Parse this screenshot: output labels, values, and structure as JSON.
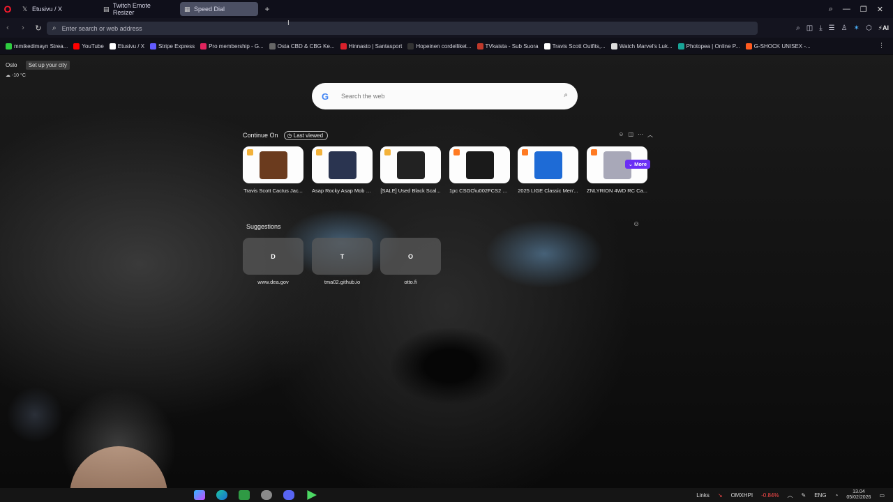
{
  "tabs": [
    {
      "label": "Etusivu / X",
      "icon": "x-logo-icon",
      "active": false
    },
    {
      "label": "Twitch Emote Resizer",
      "icon": "page-icon",
      "active": false
    },
    {
      "label": "Speed Dial",
      "icon": "speed-dial-icon",
      "active": true
    }
  ],
  "address": {
    "placeholder": "Enter search or web address"
  },
  "bookmarks": [
    {
      "label": "mmikedimayn Strea...",
      "color": "#2ecc40"
    },
    {
      "label": "YouTube",
      "color": "#ff0000"
    },
    {
      "label": "Etusivu / X",
      "color": "#ffffff"
    },
    {
      "label": "Stripe Express",
      "color": "#635bff"
    },
    {
      "label": "Pro membership - G...",
      "color": "#e0245e"
    },
    {
      "label": "Osta CBD & CBG Ke...",
      "color": "#666666"
    },
    {
      "label": "Hinnasto | Santasport",
      "color": "#d9202b"
    },
    {
      "label": "Hopeinen cordelliket...",
      "color": "#333333"
    },
    {
      "label": "TVkaista - Sub Suora",
      "color": "#c0392b"
    },
    {
      "label": "Travis Scott Outfits,...",
      "color": "#ffffff"
    },
    {
      "label": "Watch Marvel's Luk...",
      "color": "#dddddd"
    },
    {
      "label": "Photopea | Online P...",
      "color": "#18a497"
    },
    {
      "label": "G-SHOCK UNISEX -...",
      "color": "#ff5a1f"
    }
  ],
  "weather": {
    "city": "Oslo",
    "setup": "Set up your city",
    "temp": "-10 °C"
  },
  "search": {
    "placeholder": "Search the web",
    "engine": "G"
  },
  "continue_on": {
    "title": "Continue On",
    "filter": "Last viewed",
    "more": "More",
    "items": [
      {
        "label": "Travis Scott Cactus Jac...",
        "tag_color": "#f3b23a",
        "img_color": "#6b3b1e"
      },
      {
        "label": "Asap Rocky Asap Mob x...",
        "tag_color": "#f3b23a",
        "img_color": "#2a3450"
      },
      {
        "label": "[SALE] Used Black Scal...",
        "tag_color": "#f3b23a",
        "img_color": "#222222"
      },
      {
        "label": "1pc CSGO\\u002FCS2 E...",
        "tag_color": "#ff7a22",
        "img_color": "#1a1a1a"
      },
      {
        "label": "2025 LIGE Classic Men'...",
        "tag_color": "#ff7a22",
        "img_color": "#1e6bd6"
      },
      {
        "label": "ZNLYRION 4WD RC Ca...",
        "tag_color": "#ff7a22",
        "img_color": "#a8a8b8"
      }
    ]
  },
  "suggestions": {
    "title": "Suggestions",
    "items": [
      {
        "letter": "D",
        "label": "www.dea.gov"
      },
      {
        "letter": "T",
        "label": "tma02.github.io"
      },
      {
        "letter": "O",
        "label": "otto.fi"
      }
    ]
  },
  "taskbar": {
    "links": "Links",
    "ticker": "OMXHPI",
    "change": "-0.84%",
    "lang": "ENG",
    "time": "13.04",
    "date": "05/02/2026"
  }
}
